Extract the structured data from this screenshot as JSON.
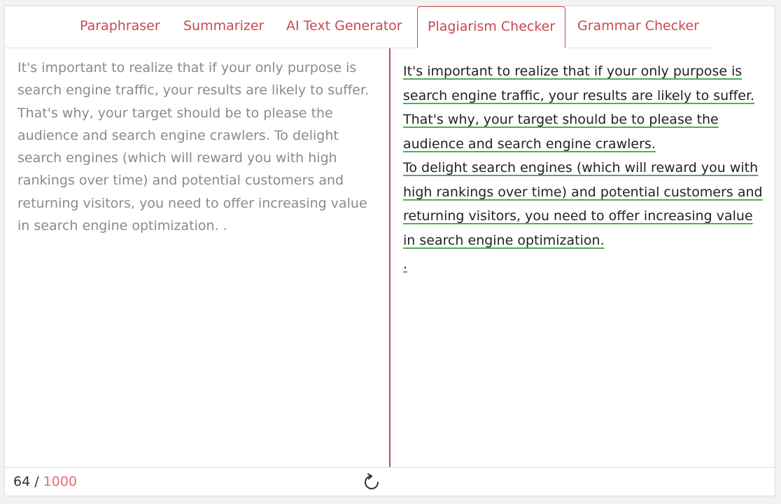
{
  "tabs": [
    {
      "label": "Paraphraser",
      "active": false
    },
    {
      "label": "Summarizer",
      "active": false
    },
    {
      "label": "AI Text Generator",
      "active": false
    },
    {
      "label": "Plagiarism Checker",
      "active": true
    },
    {
      "label": "Grammar Checker",
      "active": false
    }
  ],
  "input": {
    "text": "It's important to realize that if your only purpose is search engine traffic, your results are likely to suffer. That's why, your target should be to please the audience and search engine crawlers. To delight search engines (which will reward you with high rankings over time) and potential customers and returning visitors, you need to offer increasing value in search engine optimization. ."
  },
  "result": {
    "sentence_1": "It's important to realize that if your only purpose is search engine traffic, your results are likely to suffer. That's why, your target should be to please the audience and search engine crawlers.",
    "sentence_2": "To delight search engines (which will reward you with high rankings over time) and potential customers and returning visitors, you need to offer increasing value in search engine optimization.",
    "trailing": "."
  },
  "footer": {
    "count": "64",
    "separator": "/",
    "max": "1000",
    "refresh_icon": "refresh-icon"
  },
  "colors": {
    "accent": "#c9484e",
    "match_underline": "#4fae4f",
    "counter_max": "#e86b7a"
  }
}
